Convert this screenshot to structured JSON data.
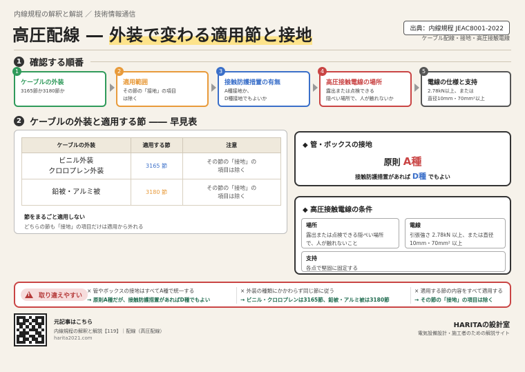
{
  "header": {
    "subtitle": "内線規程の解釈と解説 ／ 技術情報通信",
    "title_part1": "高圧配線 ―",
    "title_part2": "外装で変わる適用節と接地",
    "source_label": "出典：内線規程 JEAC8001-2022",
    "tags": "ケーブル配線・接地・高圧接触電線"
  },
  "section1": {
    "number": "1",
    "title": "確認する順番",
    "steps": [
      {
        "num": "1",
        "title": "ケーブルの外装",
        "desc1": "3165節か3180節か",
        "desc2": "",
        "color": "#2f9a5a"
      },
      {
        "num": "2",
        "title": "適用範囲",
        "desc1": "その節の「接地」の項目",
        "desc2": "は除く",
        "color": "#e89a3a"
      },
      {
        "num": "3",
        "title": "接触防護措置の有無",
        "desc1": "A種接地か、",
        "desc2": "D種接地でもよいか",
        "color": "#3a6fc9"
      },
      {
        "num": "4",
        "title": "高圧接触電線の場所",
        "desc1": "露出または点検できる",
        "desc2": "隠ぺい場所で、人が触れないか",
        "color": "#c94444"
      },
      {
        "num": "5",
        "title": "電線の仕様と支持",
        "desc1": "2.78kN以上、または",
        "desc2": "直径10mm・70mm²以上",
        "color": "#555555"
      }
    ]
  },
  "section2": {
    "number": "2",
    "title": "ケーブルの外装と適用する節 ―― 早見表",
    "table": {
      "headers": [
        "ケーブルの外装",
        "適用する節",
        "注意"
      ],
      "rows": [
        {
          "cable1": "ビニル外装",
          "cable2": "クロロプレン外装",
          "section": "3165 節",
          "note1": "その節の「接地」の",
          "note2": "項目は除く"
        },
        {
          "cable1": "鉛被・アルミ被",
          "cable2": "",
          "section": "3180 節",
          "note1": "その節の「接地」の",
          "note2": "項目は除く"
        }
      ]
    },
    "note_title": "節をまるごと適用しない",
    "note_desc": "どちらの節も「接地」の項目だけは適用から外れる"
  },
  "grounding_card": {
    "title": "管・ボックスの接地",
    "principle_prefix": "原則",
    "principle_value": "A種",
    "sub_prefix": "接触防護措置があれば",
    "sub_value": "D種",
    "sub_suffix": "でもよい"
  },
  "contact_wire_card": {
    "title": "高圧接触電線の条件",
    "place_title": "場所",
    "place_desc1": "露出または点検できる隠ぺい場所",
    "place_desc2": "で、人が触れないこと",
    "wire_title": "電線",
    "wire_desc1": "引張強さ 2.78kN 以上、または直径",
    "wire_desc2": "10mm・70mm² 以上",
    "support_title": "支持",
    "support_desc": "各点で堅固に固定する"
  },
  "warning": {
    "label": "取り違えやすい",
    "items": [
      {
        "wrong": "× 管やボックスの接地はすべてA種で統一する",
        "right": "→ 原則A種だが、接触防護措置があればD種でもよい"
      },
      {
        "wrong": "× 外装の種類にかかわらず同じ節に従う",
        "right": "→ ビニル・クロロプレンは3165節、鉛被・アルミ被は3180節"
      },
      {
        "wrong": "× 適用する節の内容をすべて適用する",
        "right": "→ その節の「接地」の項目は除く"
      }
    ]
  },
  "footer": {
    "title": "元記事はこちら",
    "desc": "内線規程の解釈と解説【119】｜配線（高圧配線）",
    "url": "harita2021.com",
    "brand": "HARITAの設計室",
    "tagline": "電気設備設計・施工者のための解説サイト"
  },
  "colors": {
    "green": "#2f9a5a",
    "orange": "#e89a3a",
    "blue": "#3a6fc9",
    "red": "#c94444",
    "gray": "#555555"
  }
}
